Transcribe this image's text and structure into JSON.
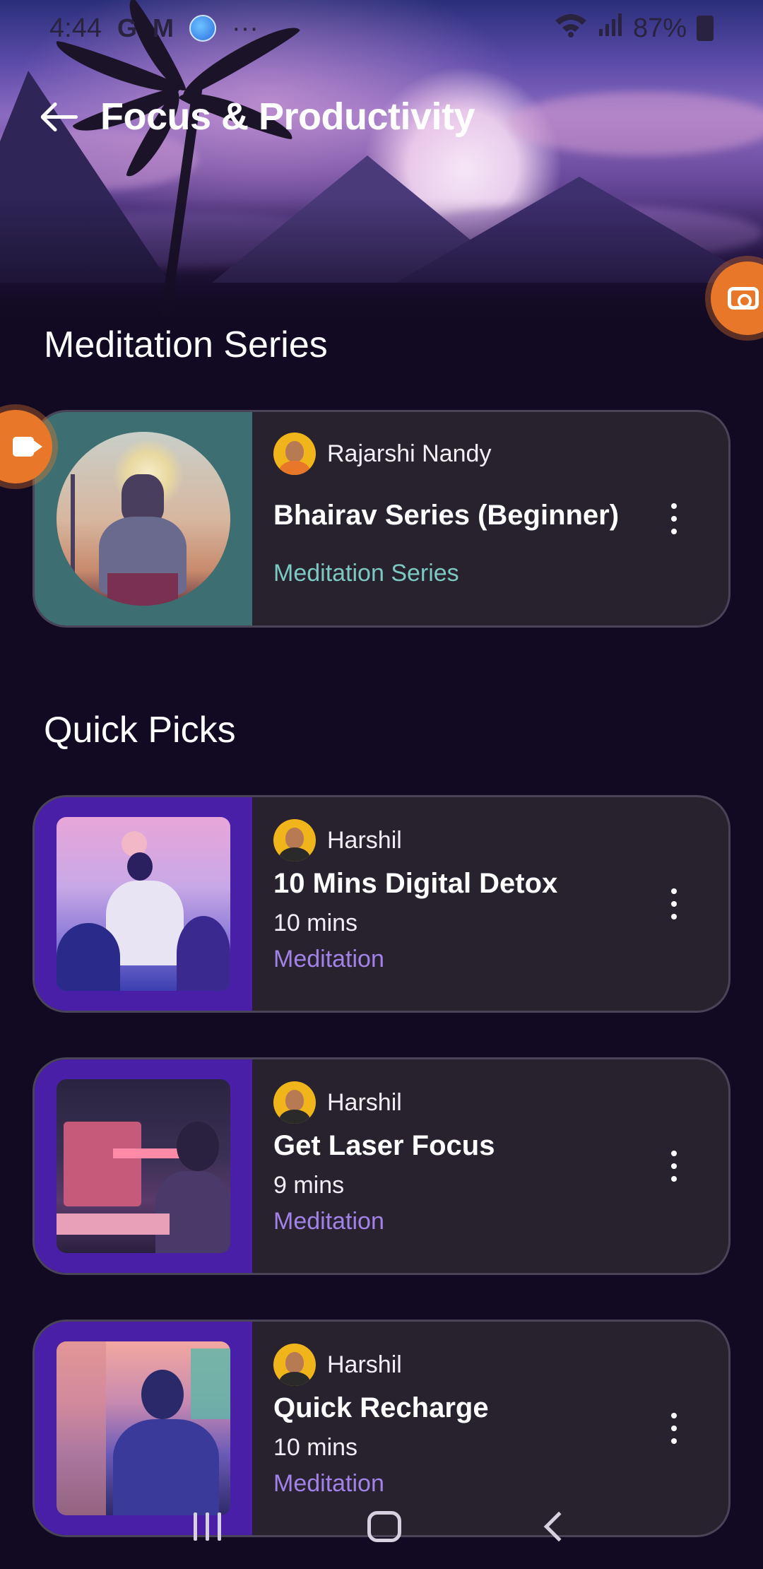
{
  "status_bar": {
    "time": "4:44",
    "notification_icons": [
      "G",
      "M"
    ],
    "overflow": "···",
    "battery": "87%"
  },
  "header": {
    "title": "Focus & Productivity"
  },
  "sections": {
    "series_title": "Meditation Series",
    "quick_picks_title": "Quick Picks"
  },
  "series_card": {
    "author": "Rajarshi Nandy",
    "title": "Bhairav Series (Beginner)",
    "category": "Meditation Series",
    "category_color": "#7cc9c4"
  },
  "quick_picks": [
    {
      "author": "Harshil",
      "title": "10 Mins Digital Detox",
      "duration": "10 mins",
      "category": "Meditation"
    },
    {
      "author": "Harshil",
      "title": "Get Laser Focus",
      "duration": "9 mins",
      "category": "Meditation"
    },
    {
      "author": "Harshil",
      "title": "Quick Recharge",
      "duration": "10 mins",
      "category": "Meditation"
    }
  ],
  "colors": {
    "background": "#120a22",
    "card": "#28222f",
    "meditation_label": "#a183e8",
    "series_label": "#7cc9c4",
    "bubble": "#e8772a"
  },
  "icons": {
    "back": "arrow-left-icon",
    "more": "more-vertical-icon",
    "camera": "camera-icon",
    "video": "video-icon"
  }
}
